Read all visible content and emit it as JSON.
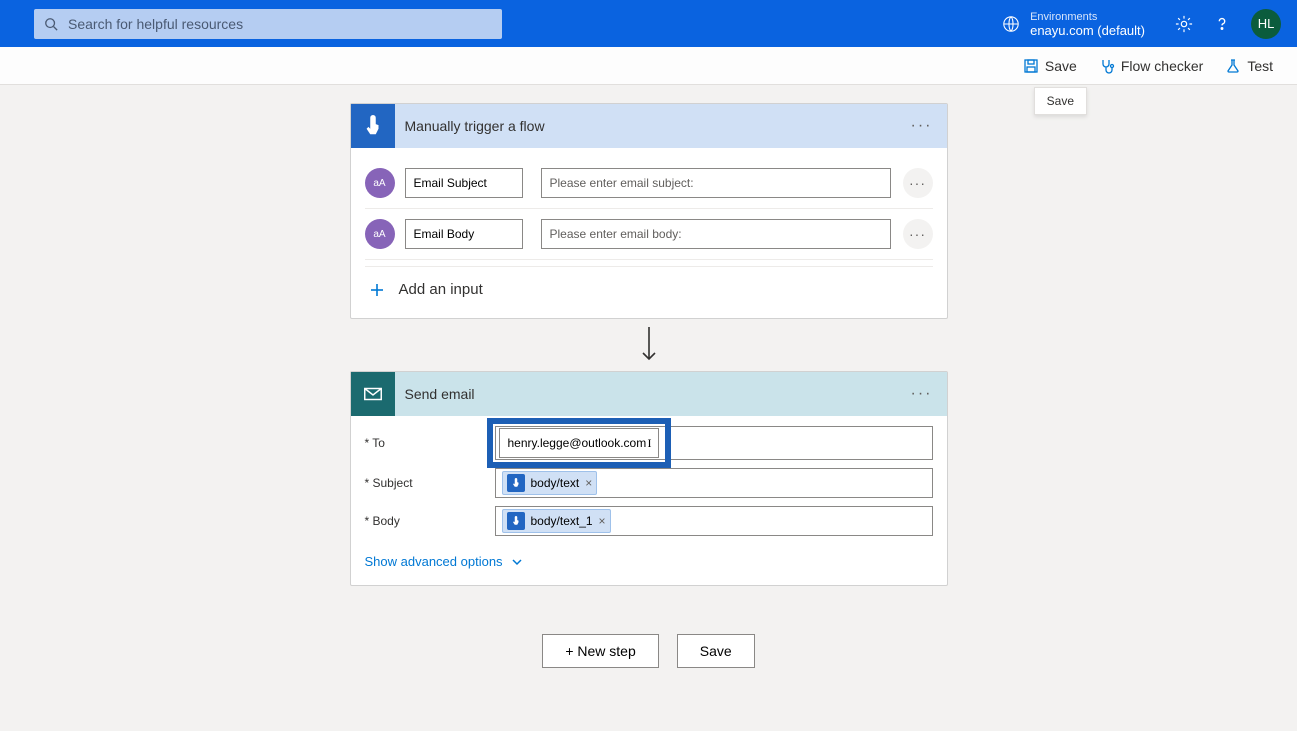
{
  "header": {
    "search_placeholder": "Search for helpful resources",
    "environments_label": "Environments",
    "environment_name": "enayu.com (default)",
    "avatar_initials": "HL"
  },
  "toolbar": {
    "save_label": "Save",
    "flow_checker_label": "Flow checker",
    "test_label": "Test",
    "tooltip": "Save"
  },
  "trigger_card": {
    "title": "Manually trigger a flow",
    "inputs": [
      {
        "type": "aA",
        "label": "Email Subject",
        "placeholder": "Please enter email subject:"
      },
      {
        "type": "aA",
        "label": "Email Body",
        "placeholder": "Please enter email body:"
      }
    ],
    "add_input_label": "Add an input"
  },
  "action_card": {
    "title": "Send email",
    "fields": {
      "to_label": "* To",
      "to_value": "henry.legge@outlook.com",
      "subject_label": "* Subject",
      "subject_token": "body/text",
      "body_label": "* Body",
      "body_token": "body/text_1"
    },
    "advanced_label": "Show advanced options"
  },
  "buttons": {
    "new_step": "+ New step",
    "save": "Save"
  }
}
